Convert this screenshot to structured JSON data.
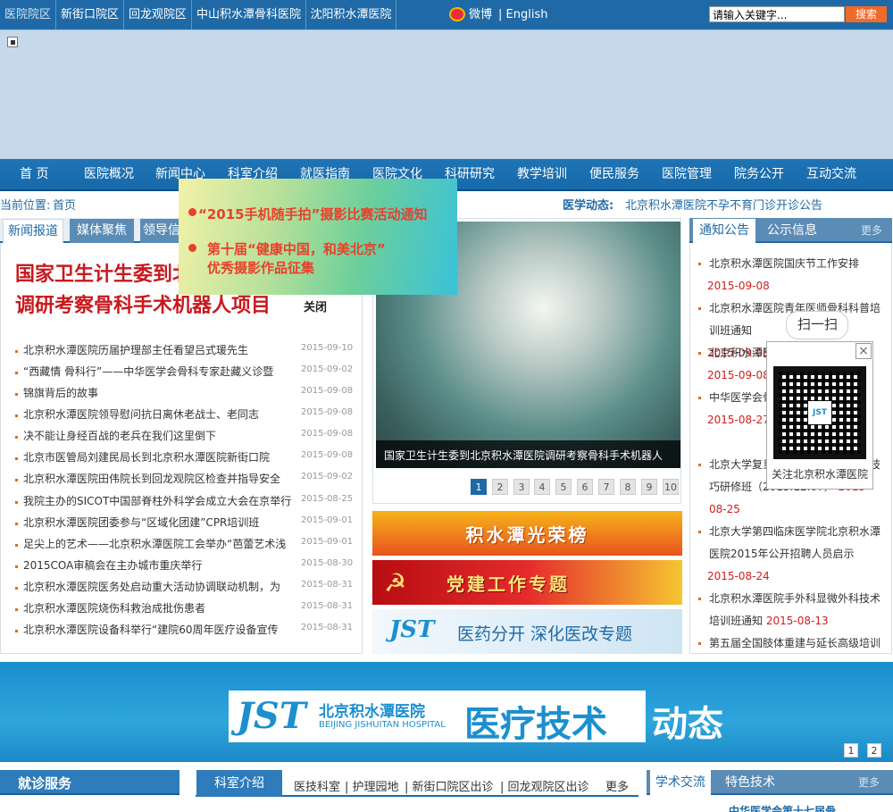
{
  "topbar": {
    "campus_tabs": [
      "医院院区",
      "新街口院区",
      "回龙观院区",
      "中山积水潭骨科医院",
      "沈阳积水潭医院"
    ],
    "weibo_label": "微博",
    "language_label": "| English",
    "search_placeholder": "请输入关键字...",
    "search_button": "搜索"
  },
  "nav": {
    "items": [
      "首 页",
      "医院概况",
      "新闻中心",
      "科室介绍",
      "就医指南",
      "医院文化",
      "科研研究",
      "教学培训",
      "便民服务",
      "医院管理",
      "院务公开",
      "互动交流"
    ]
  },
  "breadcrumb": {
    "label": "当前位置:",
    "home": "首页",
    "ticker_label": "医学动态:",
    "ticker_text": "北京积水潭医院不孕不育门诊开诊公告"
  },
  "news": {
    "tabs": [
      "新闻报道",
      "媒体聚焦",
      "领导信"
    ],
    "headline": "国家卫生计生委到北京积水潭医院调研考察骨科手术机器人项目",
    "items": [
      {
        "title": "北京积水潭医院历届护理部主任看望吕式瑗先生",
        "date": "2015-09-10"
      },
      {
        "title": "“西藏情 骨科行”——中华医学会骨科专家赴藏义诊暨",
        "date": "2015-09-02"
      },
      {
        "title": "锦旗背后的故事",
        "date": "2015-09-08"
      },
      {
        "title": "北京积水潭医院领导慰问抗日离休老战士、老同志",
        "date": "2015-09-08"
      },
      {
        "title": "决不能让身经百战的老兵在我们这里倒下",
        "date": "2015-09-08"
      },
      {
        "title": "北京市医管局刘建民局长到北京积水潭医院新街口院",
        "date": "2015-09-08"
      },
      {
        "title": "北京积水潭医院田伟院长到回龙观院区检查并指导安全",
        "date": "2015-09-02"
      },
      {
        "title": "我院主办的SICOT中国部脊柱外科学会成立大会在京举行",
        "date": "2015-08-25"
      },
      {
        "title": "北京积水潭医院团委参与“区域化团建”CPR培训班",
        "date": "2015-09-01"
      },
      {
        "title": "足尖上的艺术——北京积水潭医院工会举办“芭蕾艺术浅",
        "date": "2015-09-01"
      },
      {
        "title": "2015COA审稿会在主办城市重庆举行",
        "date": "2015-08-30"
      },
      {
        "title": "北京积水潭医院医务处启动重大活动协调联动机制，为",
        "date": "2015-08-31"
      },
      {
        "title": "北京积水潭医院烧伤科救治成批伤患者",
        "date": "2015-08-31"
      },
      {
        "title": "北京积水潭医院设备科举行“建院60周年医疗设备宣传",
        "date": "2015-08-31"
      }
    ]
  },
  "popup": {
    "line1": "“2015手机随手拍”摄影比赛活动通知",
    "line2a": "第十届“健康中国，和美北京”",
    "line2b": "优秀摄影作品征集",
    "close": "关闭"
  },
  "slider": {
    "caption": "国家卫生计生委到北京积水潭医院调研考察骨科手术机器人",
    "pages": [
      "1",
      "2",
      "3",
      "4",
      "5",
      "6",
      "7",
      "8",
      "9",
      "10"
    ],
    "active_page": "1"
  },
  "promos": {
    "honor": "积水潭光荣榜",
    "party": "党建工作专题",
    "reform_logo": "JST",
    "reform": "医药分开 深化医改专题"
  },
  "notice": {
    "tabs": [
      "通知公告",
      "公示信息"
    ],
    "more": "更多",
    "items": [
      {
        "text": "北京积水潭医院国庆节工作安排",
        "date": "2015-09-08"
      },
      {
        "text": "北京积水潭医院青年医师骨科科普培训班通知",
        "date": "2015-09-08"
      },
      {
        "text": "北京积水潭医院门诊搬迁新地址",
        "date": "2015-09-08"
      },
      {
        "text": "中华医学会骨科学分会第十届COA",
        "date": "2015-08-27"
      },
      {
        "text": "北京大学复旦大学骨科理论与实践技巧研修班（2015.12.07）",
        "date": "2015-08-25"
      },
      {
        "text": "北京大学第四临床医学院北京积水潭医院2015年公开招聘人员启示",
        "date": "2015-08-24"
      },
      {
        "text": "北京积水潭医院手外科显微外科技术培训班通知",
        "date": "2015-08-13"
      },
      {
        "text": "第五届全国肢体重建与延长高级培训",
        "date": ""
      }
    ]
  },
  "qr": {
    "bubble": "扫一扫",
    "center": "JST",
    "caption": "关注北京积水潭医院",
    "close": "×"
  },
  "tech_banner": {
    "logo": "JST",
    "name_cn": "北京积水潭医院",
    "name_en": "BEIJING JISHUITAN HOSPITAL",
    "slogan": "医疗技术",
    "slogan2": "动态",
    "pages": [
      "1",
      "2"
    ]
  },
  "bottom": {
    "service_title": "就诊服务",
    "dept_tab": "科室介绍",
    "dept_links": [
      "医技科室",
      "| 护理园地",
      "| 新街口院区出诊",
      "| 回龙观院区出诊"
    ],
    "dept_more": "更多",
    "academic_tabs": [
      "学术交流",
      "特色技术"
    ],
    "academic_more": "更多",
    "academic_peek": "中华医学会第十七届骨..."
  },
  "colors": {
    "primary": "#1f6aa6",
    "headline_red": "#c8191e",
    "date_red": "#d31c1c",
    "accent_orange": "#f06a2a"
  }
}
